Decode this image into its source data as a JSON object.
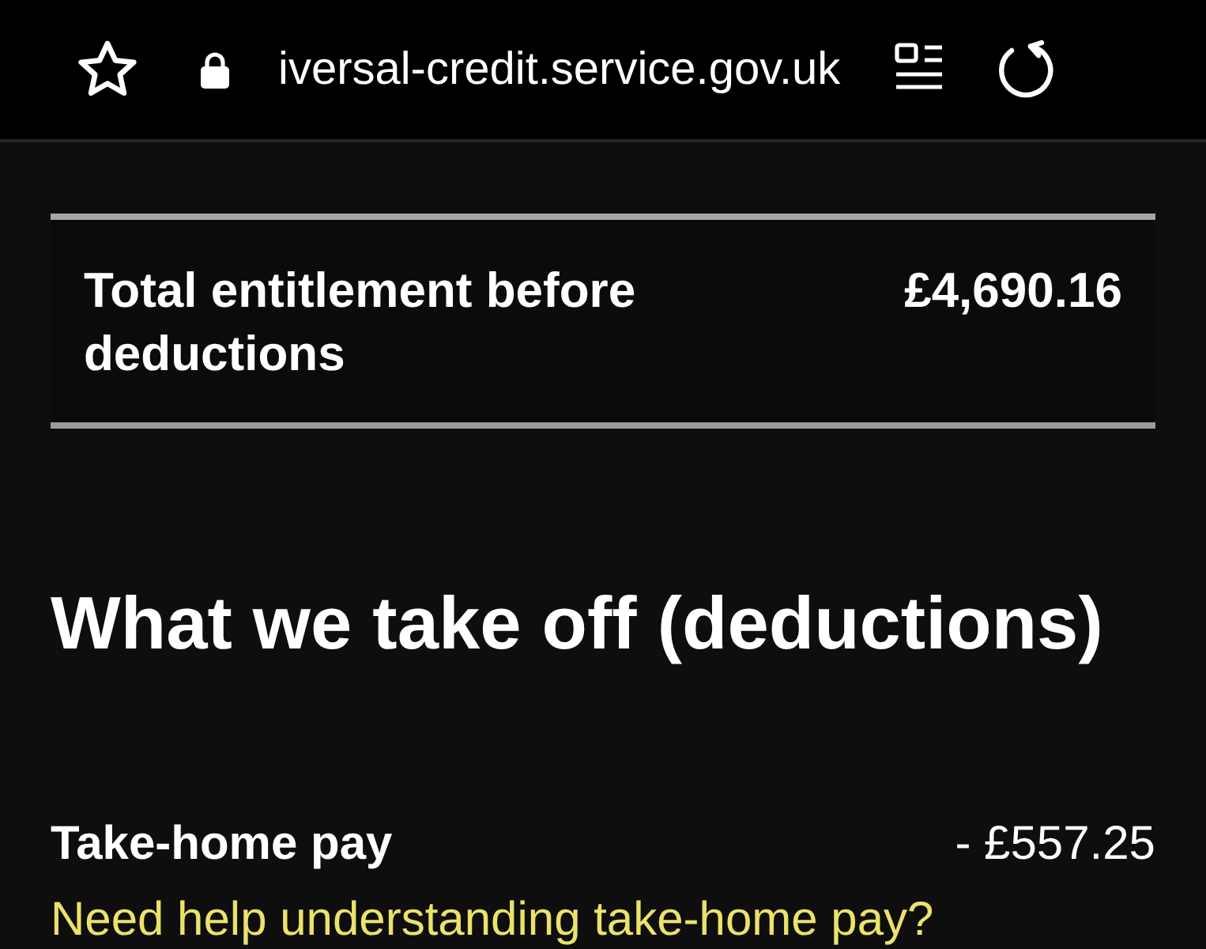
{
  "browser_bar": {
    "url": "iversal-credit.service.gov.uk"
  },
  "summary": {
    "label": "Total entitlement before deductions",
    "amount": "£4,690.16"
  },
  "deductions": {
    "heading": "What we take off (deductions)",
    "items": [
      {
        "label": "Take-home pay",
        "amount": "- £557.25",
        "link": "Need help understanding take-home pay?"
      }
    ]
  }
}
